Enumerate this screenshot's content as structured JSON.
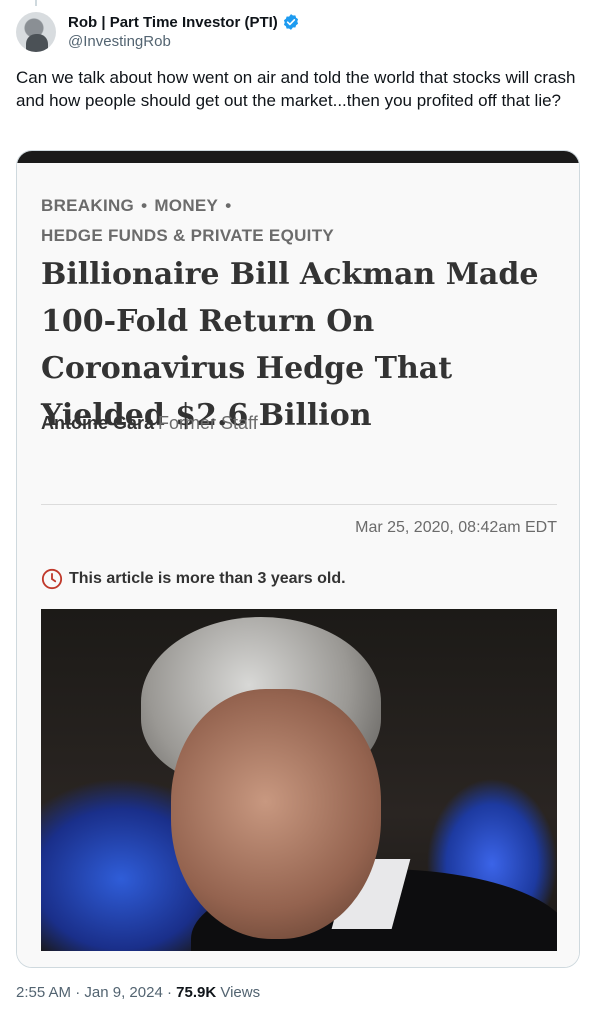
{
  "author": {
    "display_name": "Rob | Part Time Investor (PTI)",
    "handle": "@InvestingRob",
    "verified_color": "#1d9bf0"
  },
  "tweet": {
    "text": "Can we talk about how went on air and told the world that stocks will crash and how people should get out the market...then you profited off that lie?"
  },
  "article": {
    "breadcrumb": [
      "BREAKING",
      "MONEY",
      "HEDGE FUNDS & PRIVATE EQUITY"
    ],
    "breadcrumb_sep": "•",
    "headline": "Billionaire Bill Ackman Made 100-Fold Return On Coronavirus Hedge That Yielded $2.6 Billion",
    "author_name": "Antoine Gara",
    "author_role": "Former Staff",
    "date": "Mar 25, 2020, 08:42am EDT",
    "age_warning": "This article is more than 3 years old.",
    "warning_color": "#c0392b",
    "photo_icon": "portrait-photo"
  },
  "footer": {
    "time": "2:55 AM",
    "separator": "·",
    "date": "Jan 9, 2024",
    "views_count": "75.9K",
    "views_label": "Views"
  }
}
